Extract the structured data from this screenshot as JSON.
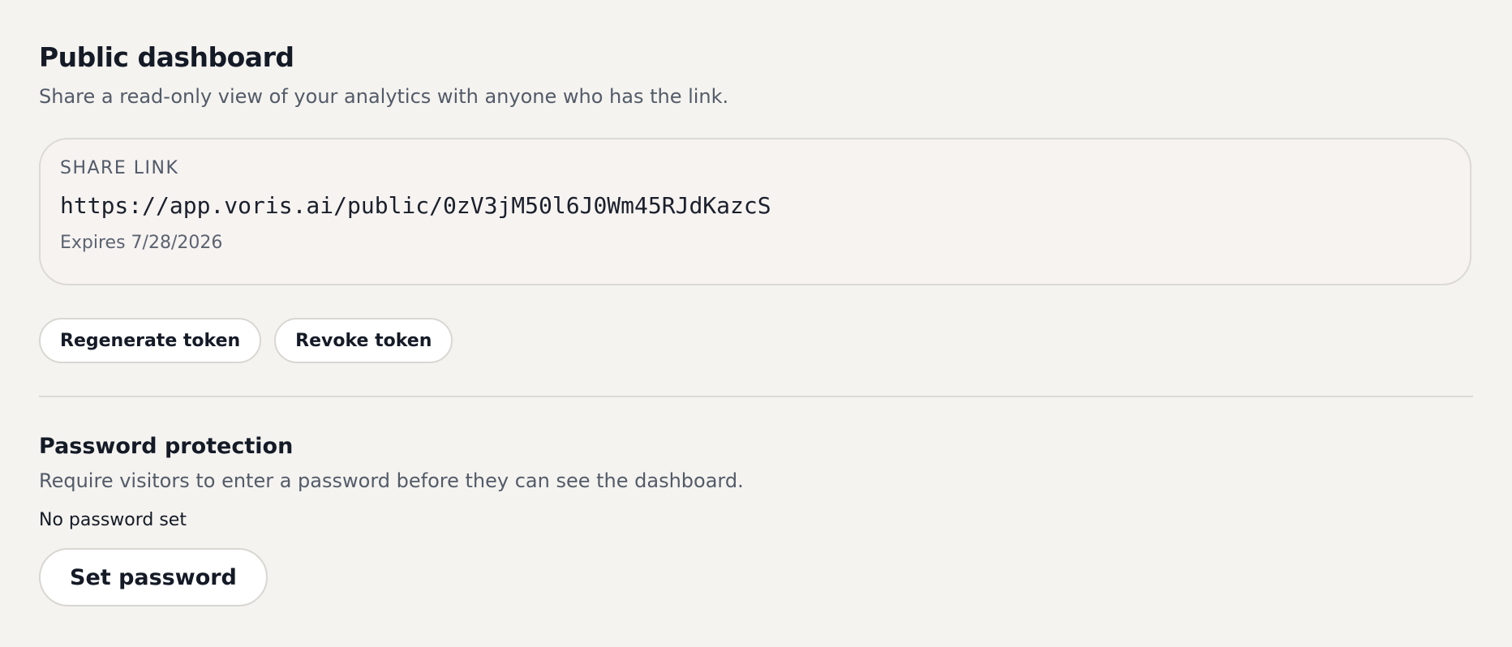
{
  "public_dashboard": {
    "title": "Public dashboard",
    "description": "Share a read-only view of your analytics with anyone who has the link.",
    "share_link": {
      "label": "SHARE LINK",
      "url": "https://app.voris.ai/public/0zV3jM50l6J0Wm45RJdKazcS",
      "expiry": "Expires 7/28/2026"
    },
    "actions": {
      "regenerate_label": "Regenerate token",
      "revoke_label": "Revoke token"
    }
  },
  "password_protection": {
    "title": "Password protection",
    "description": "Require visitors to enter a password before they can see the dashboard.",
    "status": "No password set",
    "set_password_label": "Set password"
  },
  "colors": {
    "background": "#f4f3ef",
    "text_primary": "#141a26",
    "text_secondary": "#535b69",
    "border": "#dcdad5",
    "button_background": "#ffffff"
  }
}
